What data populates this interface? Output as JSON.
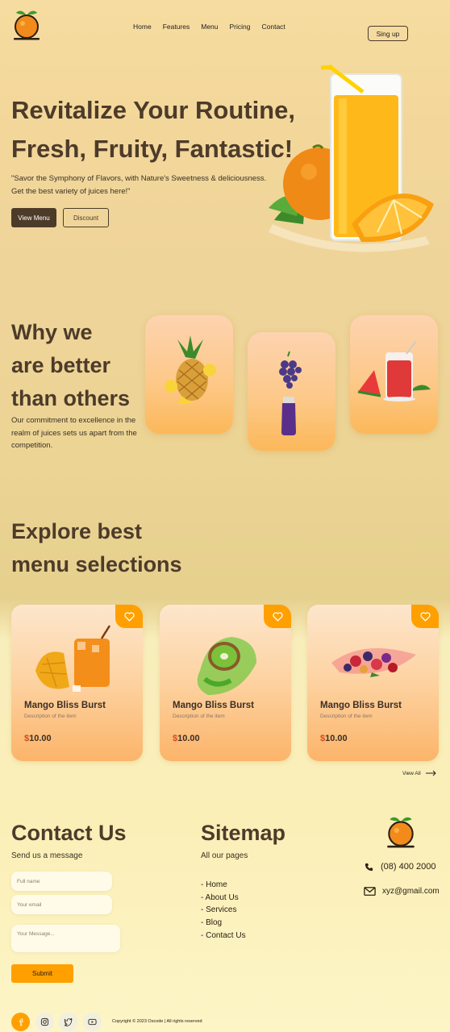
{
  "nav": {
    "links": [
      "Home",
      "Features",
      "Menu",
      "Pricing",
      "Contact"
    ],
    "signup_label": "Sing up"
  },
  "hero": {
    "title_line1": "Revitalize Your Routine,",
    "title_line2": "Fresh, Fruity, Fantastic!",
    "subtitle_line1": "\"Savor the Symphony of Flavors, with Nature's Sweetness & deliciousness.",
    "subtitle_line2": "Get the best variety of juices here!\"",
    "primary_button": "View Menu",
    "secondary_button": "Discount"
  },
  "why": {
    "title_line1": "Why we",
    "title_line2": "are better",
    "title_line3": "than others",
    "description": "Our commitment to excellence in the realm of juices sets us apart from the competition."
  },
  "explore": {
    "title_line1": "Explore best",
    "title_line2": "menu selections"
  },
  "menu_items": [
    {
      "name": "Mango Bliss Burst",
      "description": "Description of the item",
      "currency": "$",
      "price": "10.00"
    },
    {
      "name": "Mango Bliss Burst",
      "description": "Description of the item",
      "currency": "$",
      "price": "10.00"
    },
    {
      "name": "Mango Bliss Burst",
      "description": "Description of the item",
      "currency": "$",
      "price": "10.00"
    }
  ],
  "view_all_label": "View All",
  "contact": {
    "title": "Contact Us",
    "subtitle": "Send us a message",
    "name_placeholder": "Full name",
    "email_placeholder": "Your email",
    "message_placeholder": "Your Message...",
    "submit_label": "Submit"
  },
  "sitemap": {
    "title": "Sitemap",
    "subtitle": "All our pages",
    "links": [
      "- Home",
      "- About Us",
      "- Services",
      "- Blog",
      "- Contact Us"
    ]
  },
  "contact_info": {
    "phone": "(08) 400 2000",
    "email": "xyz@gmail.com"
  },
  "footer": {
    "copyright": "Copyright © 2023 Oscode | All rights reserved",
    "social_icons": [
      "facebook-icon",
      "instagram-icon",
      "twitter-icon",
      "youtube-icon"
    ]
  },
  "colors": {
    "accent": "#ffa000",
    "brown": "#4d3b2a",
    "price_symbol": "#d64a1f"
  }
}
